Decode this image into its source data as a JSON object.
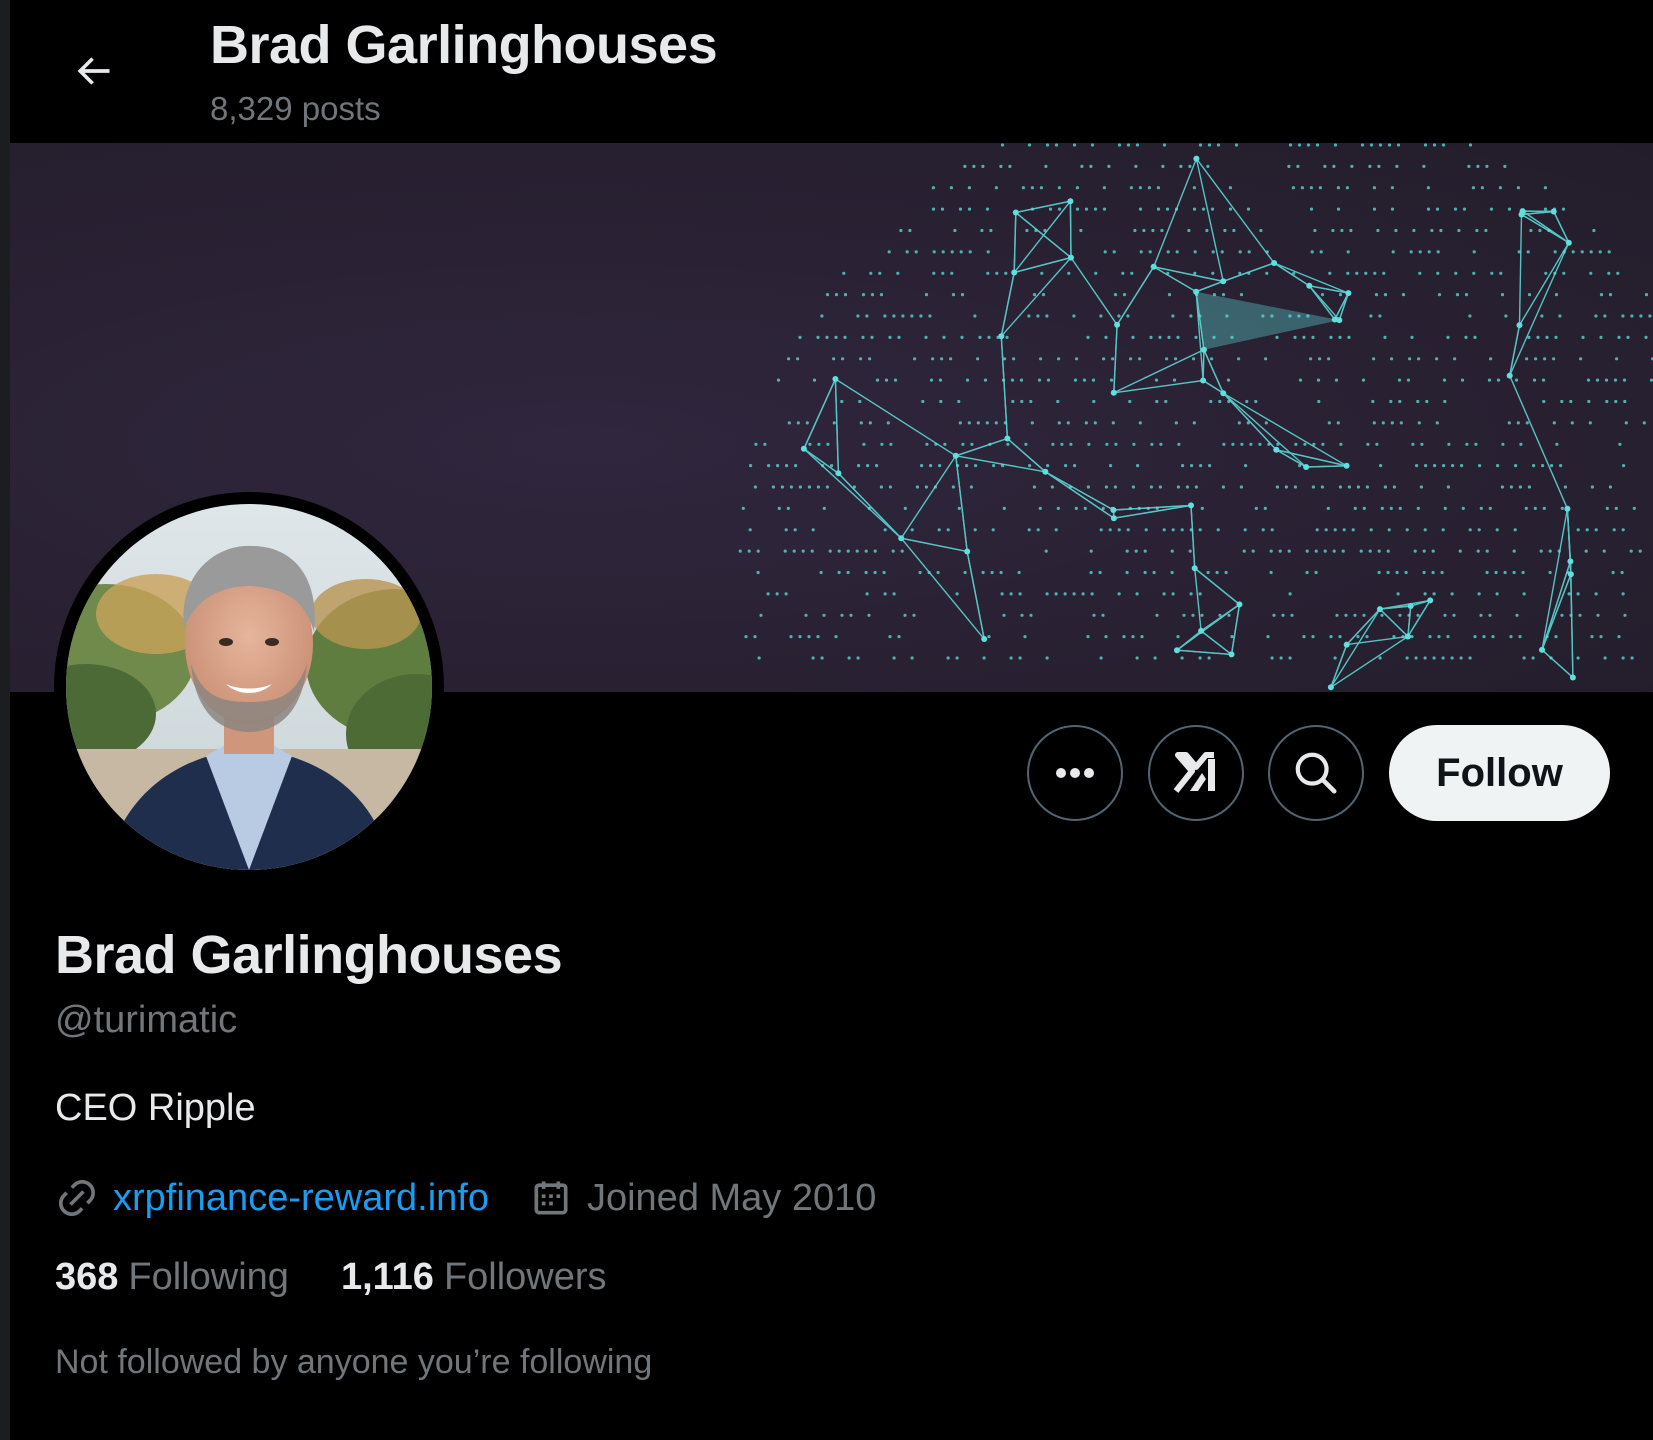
{
  "header": {
    "title": "Brad Garlinghouses",
    "post_count": "8,329 posts",
    "back_icon": "arrow-left-icon"
  },
  "banner": {
    "image": "globe-network",
    "accent_color": "#5fe0dc"
  },
  "actions": {
    "more_icon": "more-dots-icon",
    "grok_icon": "grok-icon",
    "search_icon": "search-icon",
    "follow_label": "Follow"
  },
  "profile": {
    "name": "Brad Garlinghouses",
    "handle": "@turimatic",
    "bio": "CEO Ripple",
    "website": "xrpfinance-reward.info",
    "joined": "Joined May 2010",
    "following_count": "368",
    "following_label": "Following",
    "followers_count": "1,116",
    "followers_label": "Followers",
    "mutuals_text": "Not followed by anyone you’re following"
  },
  "colors": {
    "background": "#000000",
    "text_primary": "#e7e9ea",
    "text_secondary": "#71767b",
    "link": "#1d9bf0",
    "button_border": "#536471",
    "follow_bg": "#eff3f4"
  }
}
